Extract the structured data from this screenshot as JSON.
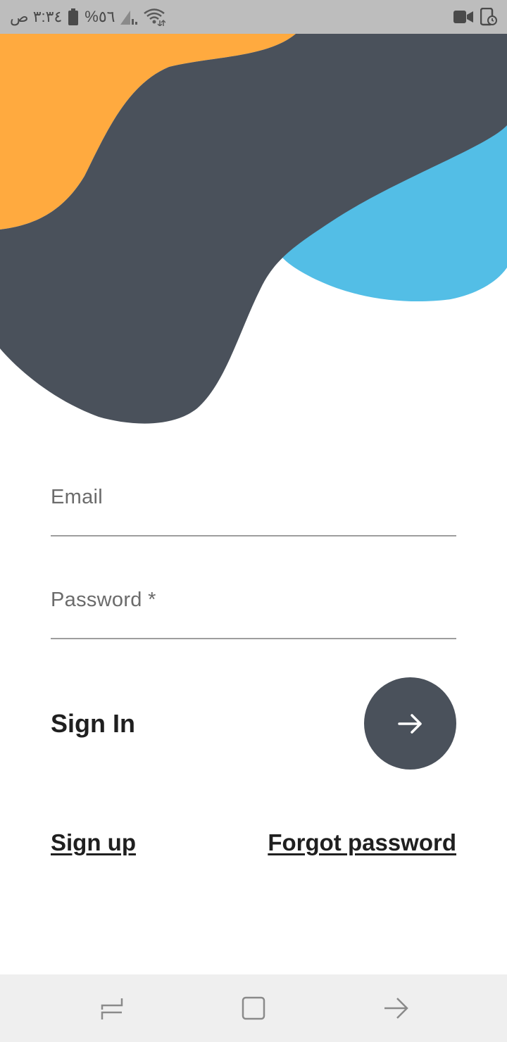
{
  "status_bar": {
    "time": "٣:٣٤ ص",
    "battery_percent": "%٥٦",
    "icons": [
      "battery-icon",
      "signal-icon",
      "wifi-icon",
      "video-camera-icon",
      "screen-record-icon"
    ]
  },
  "theme": {
    "orange": "#FFAA3F",
    "dark": "#4A515B",
    "blue": "#53BEE6"
  },
  "form": {
    "email_label": "Email",
    "password_label": "Password *",
    "signin_title": "Sign In",
    "submit_icon": "arrow-right-icon"
  },
  "links": {
    "signup": "Sign up",
    "forgot": "Forgot password"
  },
  "nav_bar": {
    "icons": [
      "recents-icon",
      "home-icon",
      "back-icon"
    ]
  }
}
